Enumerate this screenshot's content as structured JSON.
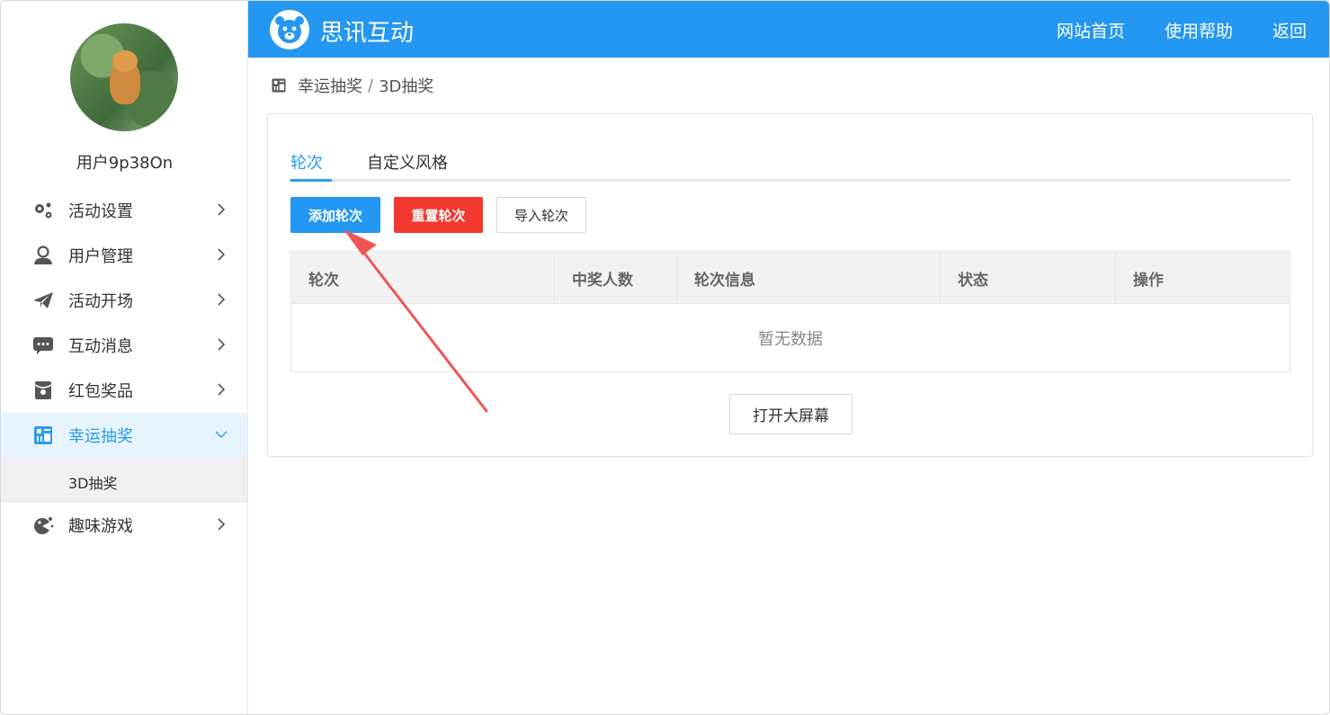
{
  "sidebar": {
    "avatar_alt": "",
    "username": "用户9p38On",
    "items": [
      {
        "label": "活动设置",
        "icon": "gears-icon"
      },
      {
        "label": "用户管理",
        "icon": "user-icon"
      },
      {
        "label": "活动开场",
        "icon": "paper-plane-icon"
      },
      {
        "label": "互动消息",
        "icon": "chat-icon"
      },
      {
        "label": "红包奖品",
        "icon": "red-envelope-icon"
      },
      {
        "label": "幸运抽奖",
        "icon": "lottery-icon",
        "active": true
      },
      {
        "label": "趣味游戏",
        "icon": "game-icon"
      }
    ],
    "submenu": {
      "label": "3D抽奖"
    }
  },
  "header": {
    "brand": "思讯互动",
    "nav": [
      "网站首页",
      "使用帮助",
      "返回"
    ],
    "color": "#2497f2"
  },
  "breadcrumb": {
    "parent": "幸运抽奖",
    "separator": "/",
    "current": "3D抽奖"
  },
  "tabs": [
    "轮次",
    "自定义风格"
  ],
  "buttons": {
    "add": "添加轮次",
    "reset": "重置轮次",
    "import": "导入轮次",
    "open_screen": "打开大屏幕"
  },
  "table": {
    "headers": [
      "轮次",
      "中奖人数",
      "轮次信息",
      "状态",
      "操作"
    ],
    "empty_text": "暂无数据"
  },
  "colors": {
    "primary": "#2497f2",
    "danger": "#f3382f",
    "active_text": "#2a9cf0",
    "annotation_arrow": "#f05555"
  }
}
